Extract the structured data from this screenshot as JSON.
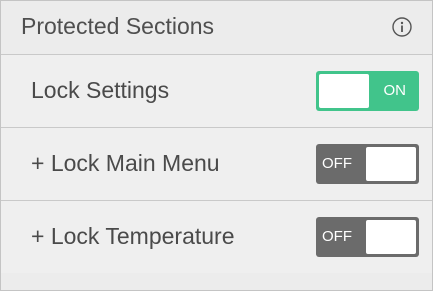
{
  "header": {
    "title": "Protected Sections",
    "info_icon": "info-circle-icon"
  },
  "rows": [
    {
      "label": "Lock Settings",
      "toggle": {
        "state": "ON",
        "on": true,
        "color": "#41c48b"
      }
    },
    {
      "label": "+ Lock Main Menu",
      "toggle": {
        "state": "OFF",
        "on": false,
        "color": "#6b6b6b"
      }
    },
    {
      "label": "+ Lock Temperature",
      "toggle": {
        "state": "OFF",
        "on": false,
        "color": "#6b6b6b"
      }
    }
  ]
}
